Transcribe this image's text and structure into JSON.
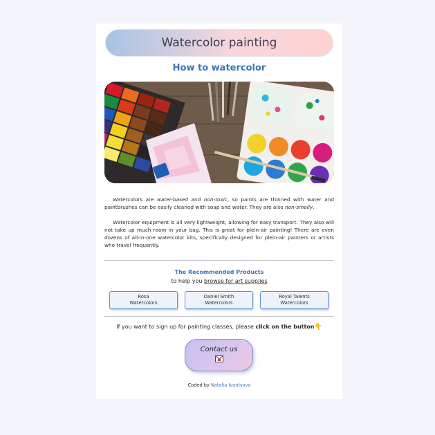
{
  "header": {
    "title": "Watercolor painting"
  },
  "section": {
    "title": "How to watercolor"
  },
  "paragraphs": {
    "p1": {
      "a": "Watercolors are ",
      "b": "water-based",
      "c": " and ",
      "d": "non-toxic",
      "e": ", so paints are thinned with water and paintbrushes can be easily cleaned with soap and water. They are also ",
      "f": "non-smelly",
      "g": "."
    },
    "p2": "Watercolor equipment is all very lightweight, allowing for easy transport. They also will not take up much room in your bag. This is great for plein-air painting! There are even dozens of all-in-one watercolor kits, specifically designed for plein-air painters or artists who travel frequently."
  },
  "recommended": {
    "title": "The Recommended Products",
    "prefix": "to help you ",
    "link": "browse for art supplies",
    "products": [
      {
        "line1": "Rosa",
        "line2": "Watercolors"
      },
      {
        "line1": "Daniel Smith",
        "line2": "Watercolors"
      },
      {
        "line1": "Royal Talents",
        "line2": "Watercolors"
      }
    ]
  },
  "signup": {
    "text": "If you want to sign up for painting classes, please ",
    "bold": "click on the button"
  },
  "contact": {
    "label": "Contact us"
  },
  "footer": {
    "prefix": "Coded by ",
    "author": "Natalia Ivantsova"
  },
  "icons": {
    "pointer": "pointing-hand-icon",
    "envelope": "envelope-icon"
  }
}
